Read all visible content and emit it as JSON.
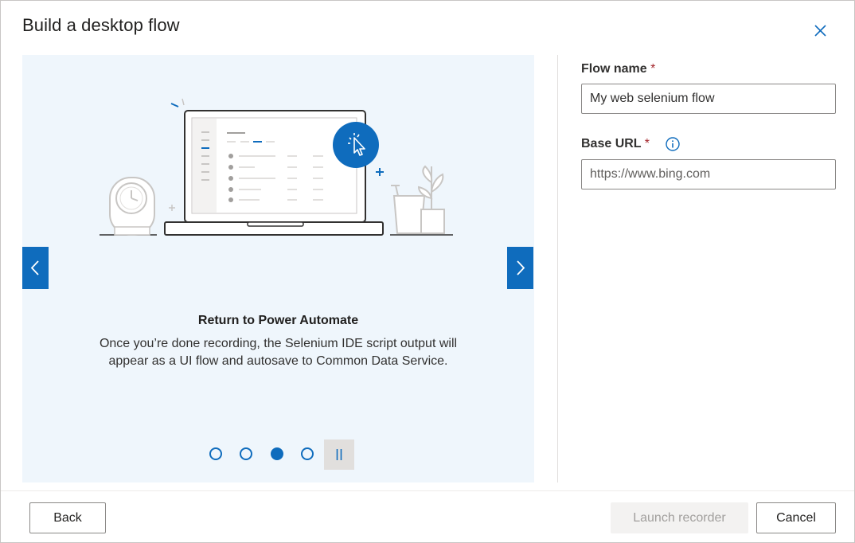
{
  "dialog": {
    "title": "Build a desktop flow",
    "close_icon": "close-icon"
  },
  "carousel": {
    "slide_heading": "Return to Power Automate",
    "slide_body": "Once you’re done recording, the Selenium IDE script output will appear as a UI flow and autosave to Common Data Service.",
    "prev_icon": "chevron-left-icon",
    "next_icon": "chevron-right-icon",
    "dots": [
      {
        "active": false
      },
      {
        "active": false
      },
      {
        "active": true
      },
      {
        "active": false
      }
    ],
    "active_slide": 3,
    "total_slides": 4,
    "pause_icon": "pause-icon"
  },
  "form": {
    "flow_name": {
      "label": "Flow name",
      "required_mark": "*",
      "value": "My web selenium flow"
    },
    "base_url": {
      "label": "Base URL",
      "required_mark": "*",
      "info_icon": "info-icon",
      "placeholder": "https://www.bing.com",
      "value": ""
    }
  },
  "footer": {
    "back_label": "Back",
    "launch_label": "Launch recorder",
    "cancel_label": "Cancel"
  },
  "colors": {
    "accent": "#0f6cbd",
    "carousel_bg": "#eff6fc",
    "required": "#a4262c",
    "disabled_bg": "#f3f2f1",
    "disabled_text": "#a19f9d"
  }
}
